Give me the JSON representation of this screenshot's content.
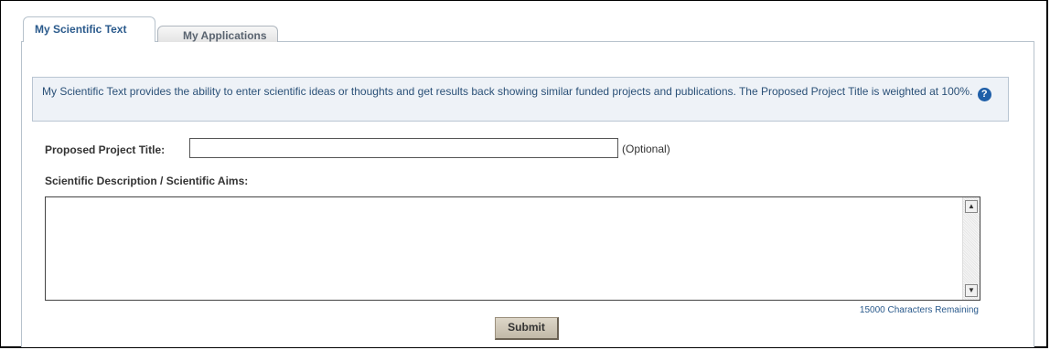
{
  "tabs": [
    {
      "label": "My Scientific Text",
      "active": true
    },
    {
      "label": "My Applications",
      "active": false
    }
  ],
  "info": {
    "text": "My Scientific Text provides the ability to enter scientific ideas or thoughts and get results back showing similar funded projects and publications. The Proposed Project Title is weighted at 100%.",
    "icon": "help-icon",
    "icon_glyph": "?"
  },
  "form": {
    "title_label": "Proposed Project Title:",
    "title_value": "",
    "title_hint": "(Optional)",
    "description_label": "Scientific Description / Scientific Aims:",
    "description_value": "",
    "remaining_text": "15000 Characters Remaining",
    "submit_label": "Submit"
  },
  "colors": {
    "accent": "#2a5a8c",
    "info_background": "#eef2f7",
    "help_icon": "#1f5fa8"
  }
}
